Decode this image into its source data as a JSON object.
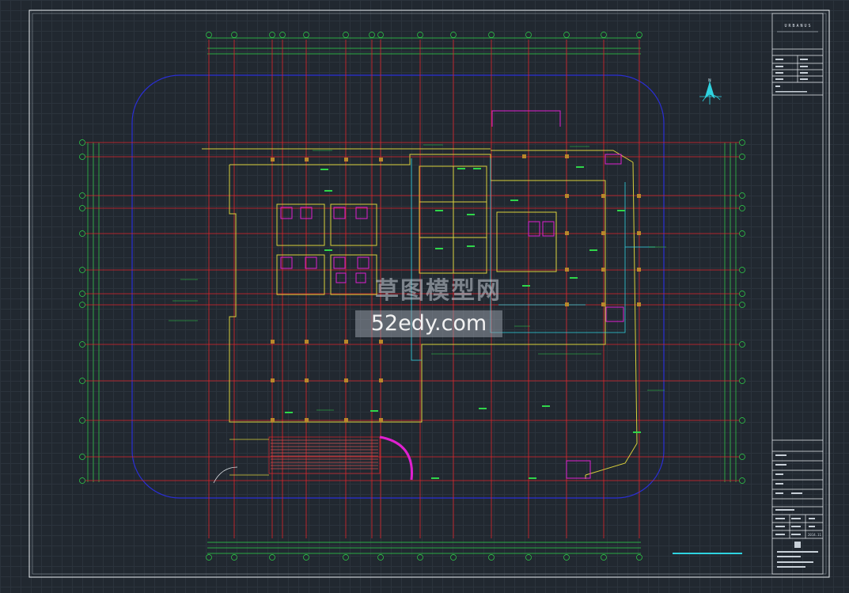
{
  "watermark": {
    "chinese": "草图模型网",
    "url": "52edy.com"
  },
  "title_block": {
    "brand": "URBANUS",
    "date": "2014.11"
  },
  "colors": {
    "background": "#212830",
    "axis_red": "#e0242a",
    "dimension_green": "#2fd64a",
    "wall_yellow": "#d9cf3a",
    "cyan": "#2fd3e0",
    "magenta": "#e020d0",
    "boundary_blue": "#2a2ed6",
    "white": "#e8ecf0"
  },
  "icons": {
    "north_arrow": "north-arrow-icon"
  }
}
